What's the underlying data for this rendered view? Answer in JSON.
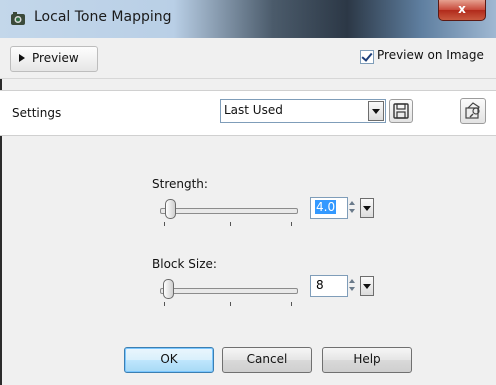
{
  "window": {
    "title": "Local Tone Mapping",
    "close_label": "x"
  },
  "preview": {
    "toggle_label": "Preview",
    "checkbox_label": "Preview on Image",
    "checkbox_checked": true
  },
  "settings": {
    "label": "Settings",
    "preset_value": "Last Used",
    "save_icon": "floppy-disk-icon",
    "load_icon": "preset-manager-icon"
  },
  "strength": {
    "label": "Strength:",
    "value": "4.0",
    "slider_fraction": 0.04
  },
  "block_size": {
    "label": "Block Size:",
    "value": "8",
    "slider_fraction": 0.02
  },
  "buttons": {
    "ok": "OK",
    "cancel": "Cancel",
    "help": "Help"
  },
  "colors": {
    "accent": "#3399ff",
    "close_red": "#c7493a"
  }
}
